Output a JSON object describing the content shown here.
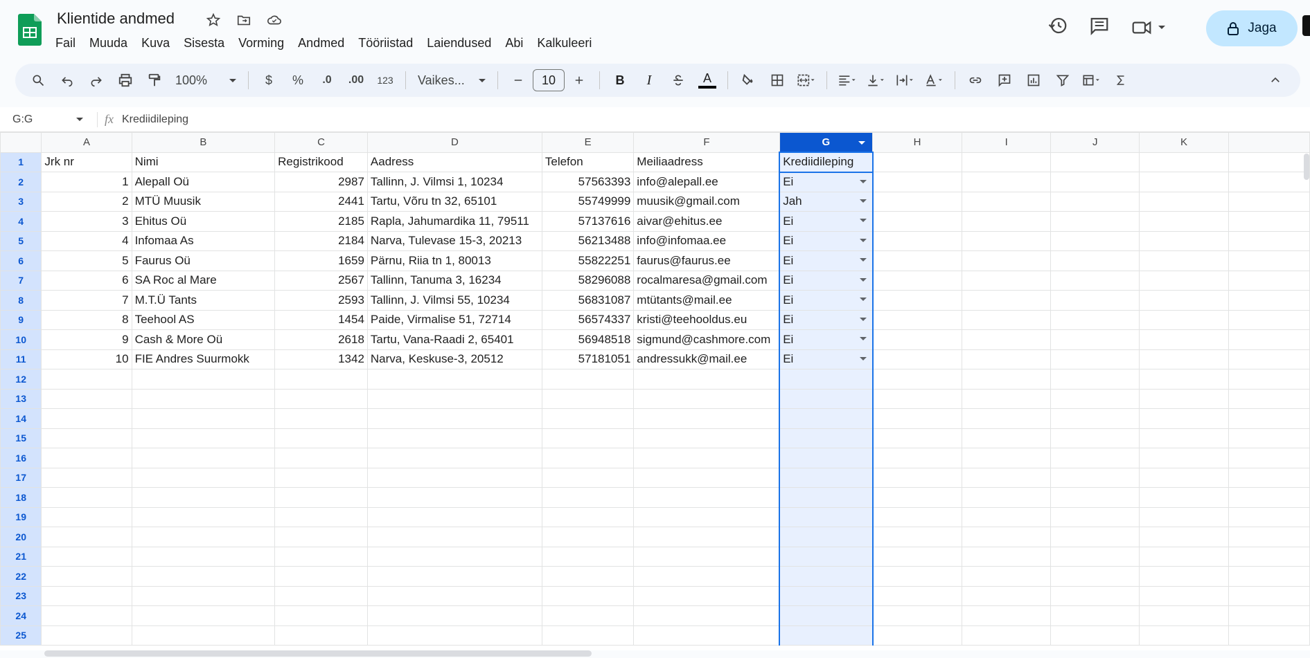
{
  "app": {
    "title": "Klientide andmed",
    "share_label": "Jaga",
    "menu": [
      "Fail",
      "Muuda",
      "Kuva",
      "Sisesta",
      "Vorming",
      "Andmed",
      "Tööriistad",
      "Laiendused",
      "Abi",
      "Kalkuleeri"
    ]
  },
  "toolbar": {
    "zoom": "100%",
    "currency": "$",
    "percent": "%",
    "dec_decrease": ".0",
    "dec_increase": ".00",
    "format_123": "123",
    "font": "Vaikes...",
    "font_size": "10",
    "bold": "B",
    "italic": "I",
    "text_color": "A"
  },
  "formula_bar": {
    "name_box": "G:G",
    "fx": "fx",
    "content": "Krediidileping"
  },
  "grid": {
    "columns": [
      "A",
      "B",
      "C",
      "D",
      "E",
      "F",
      "G",
      "H",
      "I",
      "J",
      "K"
    ],
    "selected_column": "G",
    "header_row": [
      "Jrk nr",
      "Nimi",
      "Registrikood",
      "Aadress",
      "Telefon",
      "Meiliaadress",
      "Krediidileping"
    ],
    "rows": [
      [
        "1",
        "Alepall Oü",
        "2987",
        "Tallinn, J. Vilmsi 1, 10234",
        "57563393",
        "info@alepall.ee",
        "Ei"
      ],
      [
        "2",
        "MTÜ Muusik",
        "2441",
        "Tartu, Võru tn 32, 65101",
        "55749999",
        "muusik@gmail.com",
        "Jah"
      ],
      [
        "3",
        "Ehitus Oü",
        "2185",
        "Rapla, Jahumardika 11, 79511",
        "57137616",
        "aivar@ehitus.ee",
        "Ei"
      ],
      [
        "4",
        "Infomaa As",
        "2184",
        "Narva, Tulevase 15-3, 20213",
        "56213488",
        "info@infomaa.ee",
        "Ei"
      ],
      [
        "5",
        "Faurus Oü",
        "1659",
        "Pärnu, Riia tn 1, 80013",
        "55822251",
        "faurus@faurus.ee",
        "Ei"
      ],
      [
        "6",
        "SA Roc al Mare",
        "2567",
        "Tallinn, Tanuma 3, 16234",
        "58296088",
        "rocalmaresa@gmail.com",
        "Ei"
      ],
      [
        "7",
        "M.T.Ü Tants",
        "2593",
        "Tallinn, J. Vilmsi 55, 10234",
        "56831087",
        "mtütants@mail.ee",
        "Ei"
      ],
      [
        "8",
        "Teehool AS",
        "1454",
        "Paide, Virmalise 51, 72714",
        "56574337",
        "kristi@teehooldus.eu",
        "Ei"
      ],
      [
        "9",
        "Cash & More Oü",
        "2618",
        "Tartu, Vana-Raadi 2, 65401",
        "56948518",
        "sigmund@cashmore.com",
        "Ei"
      ],
      [
        "10",
        "FIE Andres Suurmokk",
        "1342",
        "Narva, Keskuse-3, 20512",
        "57181051",
        "andressukk@mail.ee",
        "Ei"
      ]
    ],
    "row_numbers": [
      "1",
      "2",
      "3",
      "4",
      "5",
      "6",
      "7",
      "8",
      "9",
      "10",
      "11",
      "12",
      "13",
      "14",
      "15",
      "16",
      "17",
      "18",
      "19",
      "20",
      "21",
      "22",
      "23",
      "24",
      "25"
    ]
  }
}
